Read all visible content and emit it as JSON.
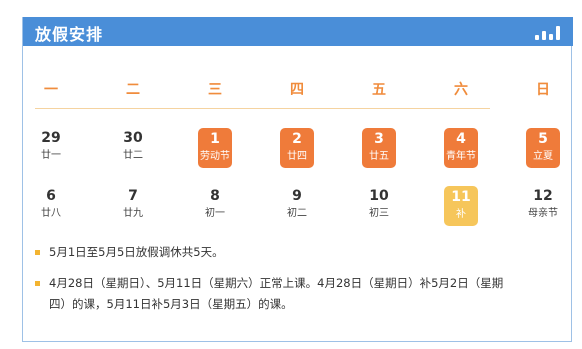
{
  "header": {
    "title": "放假安排",
    "icon": "bar-chart-icon",
    "color": "#4a8ed8"
  },
  "weekdays": [
    "一",
    "二",
    "三",
    "四",
    "五",
    "六",
    "日"
  ],
  "weeks": [
    [
      {
        "day": "29",
        "sub": "廿一",
        "type": "normal"
      },
      {
        "day": "30",
        "sub": "廿二",
        "type": "normal"
      },
      {
        "day": "1",
        "sub": "劳动节",
        "type": "holiday"
      },
      {
        "day": "2",
        "sub": "廿四",
        "type": "holiday"
      },
      {
        "day": "3",
        "sub": "廿五",
        "type": "holiday"
      },
      {
        "day": "4",
        "sub": "青年节",
        "type": "holiday"
      },
      {
        "day": "5",
        "sub": "立夏",
        "type": "holiday"
      }
    ],
    [
      {
        "day": "6",
        "sub": "廿八",
        "type": "normal"
      },
      {
        "day": "7",
        "sub": "廿九",
        "type": "normal"
      },
      {
        "day": "8",
        "sub": "初一",
        "type": "normal"
      },
      {
        "day": "9",
        "sub": "初二",
        "type": "normal"
      },
      {
        "day": "10",
        "sub": "初三",
        "type": "normal"
      },
      {
        "day": "11",
        "sub": "补",
        "type": "makeup"
      },
      {
        "day": "12",
        "sub": "母亲节",
        "type": "normal"
      }
    ]
  ],
  "notes": [
    "5月1日至5月5日放假调休共5天。",
    "4月28日（星期日）、5月11日（星期六）正常上课。4月28日（星期日）补5月2日（星期四）的课，5月11日补5月3日（星期五）的课。"
  ],
  "colors": {
    "holiday": "#ef7b3a",
    "makeup": "#f6c65b",
    "weekday_label": "#f08c3c"
  }
}
